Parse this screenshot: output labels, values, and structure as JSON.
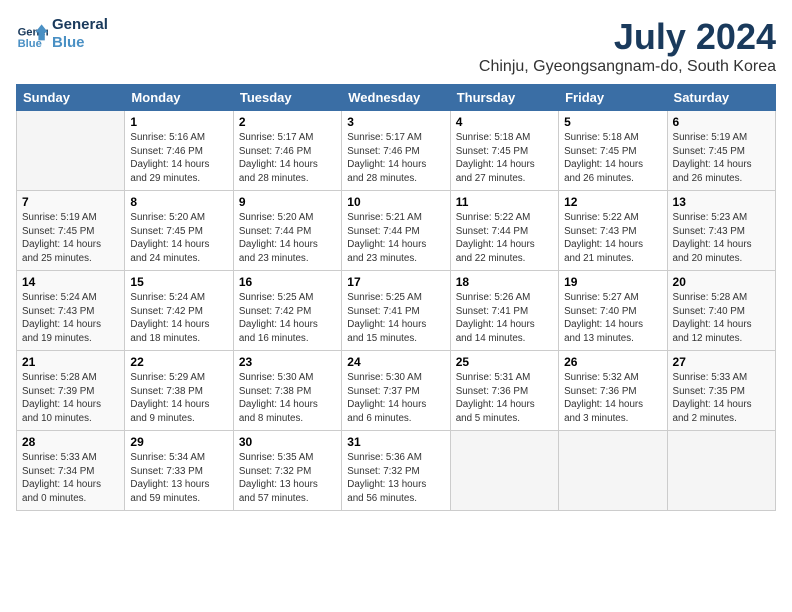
{
  "logo": {
    "line1": "General",
    "line2": "Blue"
  },
  "title": "July 2024",
  "location": "Chinju, Gyeongsangnam-do, South Korea",
  "days_of_week": [
    "Sunday",
    "Monday",
    "Tuesday",
    "Wednesday",
    "Thursday",
    "Friday",
    "Saturday"
  ],
  "weeks": [
    [
      {
        "num": "",
        "info": ""
      },
      {
        "num": "1",
        "info": "Sunrise: 5:16 AM\nSunset: 7:46 PM\nDaylight: 14 hours\nand 29 minutes."
      },
      {
        "num": "2",
        "info": "Sunrise: 5:17 AM\nSunset: 7:46 PM\nDaylight: 14 hours\nand 28 minutes."
      },
      {
        "num": "3",
        "info": "Sunrise: 5:17 AM\nSunset: 7:46 PM\nDaylight: 14 hours\nand 28 minutes."
      },
      {
        "num": "4",
        "info": "Sunrise: 5:18 AM\nSunset: 7:45 PM\nDaylight: 14 hours\nand 27 minutes."
      },
      {
        "num": "5",
        "info": "Sunrise: 5:18 AM\nSunset: 7:45 PM\nDaylight: 14 hours\nand 26 minutes."
      },
      {
        "num": "6",
        "info": "Sunrise: 5:19 AM\nSunset: 7:45 PM\nDaylight: 14 hours\nand 26 minutes."
      }
    ],
    [
      {
        "num": "7",
        "info": "Sunrise: 5:19 AM\nSunset: 7:45 PM\nDaylight: 14 hours\nand 25 minutes."
      },
      {
        "num": "8",
        "info": "Sunrise: 5:20 AM\nSunset: 7:45 PM\nDaylight: 14 hours\nand 24 minutes."
      },
      {
        "num": "9",
        "info": "Sunrise: 5:20 AM\nSunset: 7:44 PM\nDaylight: 14 hours\nand 23 minutes."
      },
      {
        "num": "10",
        "info": "Sunrise: 5:21 AM\nSunset: 7:44 PM\nDaylight: 14 hours\nand 23 minutes."
      },
      {
        "num": "11",
        "info": "Sunrise: 5:22 AM\nSunset: 7:44 PM\nDaylight: 14 hours\nand 22 minutes."
      },
      {
        "num": "12",
        "info": "Sunrise: 5:22 AM\nSunset: 7:43 PM\nDaylight: 14 hours\nand 21 minutes."
      },
      {
        "num": "13",
        "info": "Sunrise: 5:23 AM\nSunset: 7:43 PM\nDaylight: 14 hours\nand 20 minutes."
      }
    ],
    [
      {
        "num": "14",
        "info": "Sunrise: 5:24 AM\nSunset: 7:43 PM\nDaylight: 14 hours\nand 19 minutes."
      },
      {
        "num": "15",
        "info": "Sunrise: 5:24 AM\nSunset: 7:42 PM\nDaylight: 14 hours\nand 18 minutes."
      },
      {
        "num": "16",
        "info": "Sunrise: 5:25 AM\nSunset: 7:42 PM\nDaylight: 14 hours\nand 16 minutes."
      },
      {
        "num": "17",
        "info": "Sunrise: 5:25 AM\nSunset: 7:41 PM\nDaylight: 14 hours\nand 15 minutes."
      },
      {
        "num": "18",
        "info": "Sunrise: 5:26 AM\nSunset: 7:41 PM\nDaylight: 14 hours\nand 14 minutes."
      },
      {
        "num": "19",
        "info": "Sunrise: 5:27 AM\nSunset: 7:40 PM\nDaylight: 14 hours\nand 13 minutes."
      },
      {
        "num": "20",
        "info": "Sunrise: 5:28 AM\nSunset: 7:40 PM\nDaylight: 14 hours\nand 12 minutes."
      }
    ],
    [
      {
        "num": "21",
        "info": "Sunrise: 5:28 AM\nSunset: 7:39 PM\nDaylight: 14 hours\nand 10 minutes."
      },
      {
        "num": "22",
        "info": "Sunrise: 5:29 AM\nSunset: 7:38 PM\nDaylight: 14 hours\nand 9 minutes."
      },
      {
        "num": "23",
        "info": "Sunrise: 5:30 AM\nSunset: 7:38 PM\nDaylight: 14 hours\nand 8 minutes."
      },
      {
        "num": "24",
        "info": "Sunrise: 5:30 AM\nSunset: 7:37 PM\nDaylight: 14 hours\nand 6 minutes."
      },
      {
        "num": "25",
        "info": "Sunrise: 5:31 AM\nSunset: 7:36 PM\nDaylight: 14 hours\nand 5 minutes."
      },
      {
        "num": "26",
        "info": "Sunrise: 5:32 AM\nSunset: 7:36 PM\nDaylight: 14 hours\nand 3 minutes."
      },
      {
        "num": "27",
        "info": "Sunrise: 5:33 AM\nSunset: 7:35 PM\nDaylight: 14 hours\nand 2 minutes."
      }
    ],
    [
      {
        "num": "28",
        "info": "Sunrise: 5:33 AM\nSunset: 7:34 PM\nDaylight: 14 hours\nand 0 minutes."
      },
      {
        "num": "29",
        "info": "Sunrise: 5:34 AM\nSunset: 7:33 PM\nDaylight: 13 hours\nand 59 minutes."
      },
      {
        "num": "30",
        "info": "Sunrise: 5:35 AM\nSunset: 7:32 PM\nDaylight: 13 hours\nand 57 minutes."
      },
      {
        "num": "31",
        "info": "Sunrise: 5:36 AM\nSunset: 7:32 PM\nDaylight: 13 hours\nand 56 minutes."
      },
      {
        "num": "",
        "info": ""
      },
      {
        "num": "",
        "info": ""
      },
      {
        "num": "",
        "info": ""
      }
    ]
  ]
}
